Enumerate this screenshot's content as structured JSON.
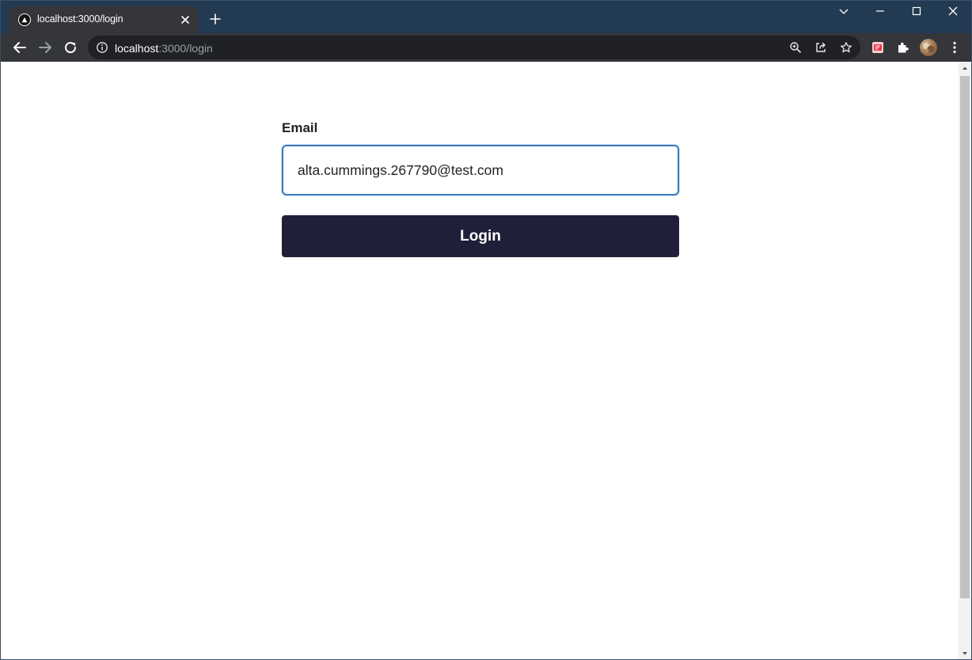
{
  "browser": {
    "tab_title": "localhost:3000/login",
    "url_host": "localhost",
    "url_path": ":3000/login",
    "colors": {
      "titlebar": "#233a53",
      "toolbar": "#35363a",
      "omnibox": "#202124"
    },
    "icons": {
      "favicon": "nextjs-triangle-icon",
      "tab_close": "close-icon",
      "new_tab": "plus-icon",
      "tab_search": "chevron-down-icon",
      "minimize": "minimize-icon",
      "maximize": "maximize-icon",
      "close_window": "close-icon",
      "back": "arrow-left-icon",
      "forward": "arrow-right-icon",
      "reload": "reload-icon",
      "site_info": "info-icon",
      "zoom": "zoom-icon",
      "share": "share-icon",
      "bookmark": "star-icon",
      "extension_pdf": "pdf-extension-icon",
      "extensions": "puzzle-icon",
      "profile": "avatar",
      "menu": "kebab-menu-icon"
    }
  },
  "login": {
    "email_label": "Email",
    "email_value": "alta.cummings.267790@test.com",
    "button_label": "Login",
    "colors": {
      "button_bg": "#1f1f3a",
      "input_border": "#3a7bbf"
    }
  }
}
